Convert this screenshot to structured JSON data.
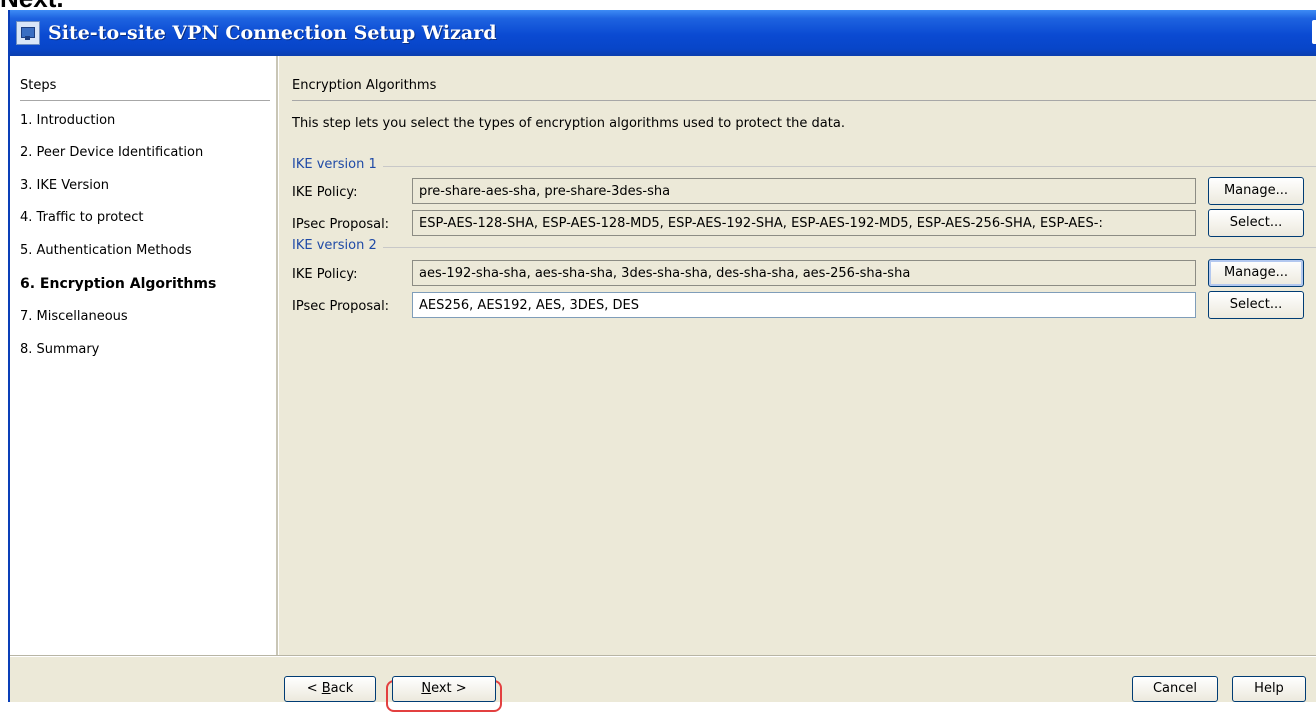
{
  "caption": "Next.",
  "window": {
    "title": "Site-to-site VPN Connection Setup Wizard"
  },
  "steps": {
    "header": "Steps",
    "items": [
      {
        "label": "1. Introduction",
        "current": false
      },
      {
        "label": "2. Peer Device Identification",
        "current": false
      },
      {
        "label": "3. IKE Version",
        "current": false
      },
      {
        "label": "4. Traffic to protect",
        "current": false
      },
      {
        "label": "5. Authentication Methods",
        "current": false
      },
      {
        "label": "6. Encryption Algorithms",
        "current": true
      },
      {
        "label": "7. Miscellaneous",
        "current": false
      },
      {
        "label": "8. Summary",
        "current": false
      }
    ]
  },
  "content": {
    "header": "Encryption Algorithms",
    "description": "This step lets you select the types of encryption algorithms used to protect the data.",
    "ike_v1": {
      "group_label": "IKE version 1",
      "policy_label": "IKE Policy:",
      "policy_value": "pre-share-aes-sha, pre-share-3des-sha",
      "policy_button": "Manage...",
      "proposal_label": "IPsec Proposal:",
      "proposal_value": "ESP-AES-128-SHA, ESP-AES-128-MD5, ESP-AES-192-SHA, ESP-AES-192-MD5, ESP-AES-256-SHA, ESP-AES-:",
      "proposal_button": "Select..."
    },
    "ike_v2": {
      "group_label": "IKE version 2",
      "policy_label": "IKE Policy:",
      "policy_value": "aes-192-sha-sha, aes-sha-sha, 3des-sha-sha, des-sha-sha, aes-256-sha-sha",
      "policy_button": "Manage...",
      "proposal_label": "IPsec Proposal:",
      "proposal_value": "AES256, AES192, AES, 3DES, DES",
      "proposal_button": "Select..."
    }
  },
  "footer": {
    "back_prefix": "< ",
    "back_mnemonic": "B",
    "back_rest": "ack",
    "next_mnemonic": "N",
    "next_rest": "ext >",
    "cancel": "Cancel",
    "help": "Help"
  }
}
